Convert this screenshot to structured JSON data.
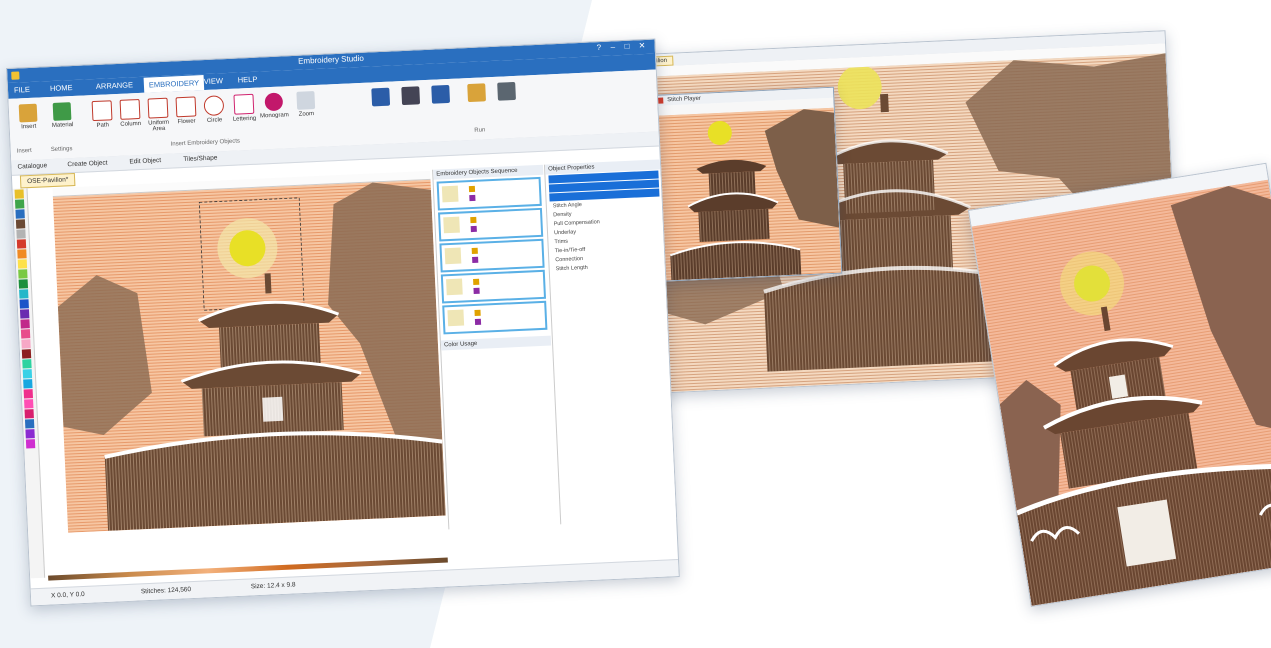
{
  "main_window": {
    "title": "Embroidery Studio",
    "window_controls": [
      "?",
      "–",
      "□",
      "✕"
    ],
    "ribbon_tabs": [
      "FILE",
      "HOME",
      "ARRANGE",
      "EMBROIDERY",
      "VIEW",
      "HELP"
    ],
    "active_tab": "EMBROIDERY",
    "ribbon_buttons": [
      "Insert",
      "Material",
      "Path",
      "Column",
      "Uniform Area",
      "Flower",
      "Circle",
      "Lettering",
      "Monogram",
      "Zoom"
    ],
    "ribbon_groups": [
      "Insert",
      "Settings",
      "Insert Embroidery Objects",
      "Run"
    ],
    "toolbar_items": [
      "Catalogue",
      "Create Object",
      "Edit Object",
      "Tiles/Shape"
    ],
    "document_tab": "OSE-Pavilion*",
    "panels": {
      "sequence_header": "Embroidery Objects Sequence",
      "colors_header": "Color Usage",
      "props_header": "Object Properties",
      "props_rows": [
        "Stitch Angle",
        "Density",
        "Pull Compensation",
        "Underlay",
        "Trims",
        "Tie-in/Tie-off",
        "Connection",
        "Stitch Length"
      ]
    },
    "status_left": "X 0.0, Y 0.0",
    "status_mid": "Stitches: 124,560",
    "status_right": "Size: 12.4 x 9.8"
  },
  "top_right_window": {
    "doc_tab": "OSE-Pavilion"
  },
  "small_window": {
    "title": "Stitch Player"
  },
  "colors": {
    "ribbon_blue": "#2a6fbf",
    "sky_peach": "#f6c6a2",
    "sun_yellow": "#e8e026",
    "building_brown": "#6b4a34",
    "tree_brown": "#8a6a52"
  }
}
